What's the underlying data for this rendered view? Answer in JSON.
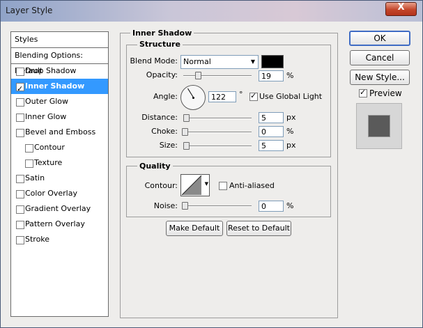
{
  "window": {
    "title": "Layer Style",
    "close_label": "X"
  },
  "styles_panel": {
    "header": "Styles",
    "items": [
      {
        "label": "Blending Options: Default",
        "checkbox": false,
        "checked": false,
        "selected": false,
        "indent": false
      },
      {
        "label": "Drop Shadow",
        "checkbox": true,
        "checked": false,
        "selected": false,
        "indent": false
      },
      {
        "label": "Inner Shadow",
        "checkbox": true,
        "checked": true,
        "selected": true,
        "indent": false
      },
      {
        "label": "Outer Glow",
        "checkbox": true,
        "checked": false,
        "selected": false,
        "indent": false
      },
      {
        "label": "Inner Glow",
        "checkbox": true,
        "checked": false,
        "selected": false,
        "indent": false
      },
      {
        "label": "Bevel and Emboss",
        "checkbox": true,
        "checked": false,
        "selected": false,
        "indent": false
      },
      {
        "label": "Contour",
        "checkbox": true,
        "checked": false,
        "selected": false,
        "indent": true
      },
      {
        "label": "Texture",
        "checkbox": true,
        "checked": false,
        "selected": false,
        "indent": true
      },
      {
        "label": "Satin",
        "checkbox": true,
        "checked": false,
        "selected": false,
        "indent": false
      },
      {
        "label": "Color Overlay",
        "checkbox": true,
        "checked": false,
        "selected": false,
        "indent": false
      },
      {
        "label": "Gradient Overlay",
        "checkbox": true,
        "checked": false,
        "selected": false,
        "indent": false
      },
      {
        "label": "Pattern Overlay",
        "checkbox": true,
        "checked": false,
        "selected": false,
        "indent": false
      },
      {
        "label": "Stroke",
        "checkbox": true,
        "checked": false,
        "selected": false,
        "indent": false
      }
    ]
  },
  "inner_shadow": {
    "title": "Inner Shadow",
    "structure": {
      "title": "Structure",
      "blend_mode_label": "Blend Mode:",
      "blend_mode_value": "Normal",
      "color": "#000000",
      "opacity_label": "Opacity:",
      "opacity_value": "19",
      "opacity_unit": "%",
      "opacity_level": 0.19,
      "angle_label": "Angle:",
      "angle_value": "122",
      "angle_unit": "°",
      "angle_degrees": 122,
      "use_global_light_label": "Use Global Light",
      "use_global_light": true,
      "distance_label": "Distance:",
      "distance_value": "5",
      "distance_unit": "px",
      "distance_level": 0.02,
      "choke_label": "Choke:",
      "choke_value": "0",
      "choke_unit": "%",
      "choke_level": 0,
      "size_label": "Size:",
      "size_value": "5",
      "size_unit": "px",
      "size_level": 0.02
    },
    "quality": {
      "title": "Quality",
      "contour_label": "Contour:",
      "anti_aliased_label": "Anti-aliased",
      "anti_aliased": false,
      "noise_label": "Noise:",
      "noise_value": "0",
      "noise_unit": "%",
      "noise_level": 0
    },
    "make_default_label": "Make Default",
    "reset_default_label": "Reset to Default"
  },
  "buttons": {
    "ok": "OK",
    "cancel": "Cancel",
    "new_style": "New Style..."
  },
  "preview": {
    "label": "Preview",
    "checked": true,
    "swatch_color": "#5a5a5a"
  },
  "colors": {
    "selection": "#3399ff",
    "dialog_bg": "#eeedeb"
  }
}
